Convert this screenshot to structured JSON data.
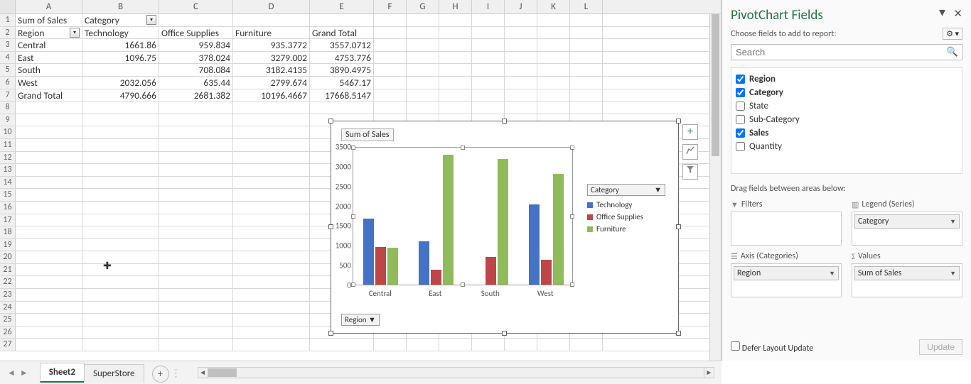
{
  "pivot": {
    "header_row": {
      "sum_label": "Sum of Sales",
      "cat_label": "Category"
    },
    "col_row": {
      "region_label": "Region",
      "c1": "Technology",
      "c2": "Office Supplies",
      "c3": "Furniture",
      "c4": "Grand Total"
    },
    "rows": [
      {
        "region": "Central",
        "tech": "1661.86",
        "off": "959.834",
        "fur": "935.3772",
        "tot": "3557.0712"
      },
      {
        "region": "East",
        "tech": "1096.75",
        "off": "378.024",
        "fur": "3279.002",
        "tot": "4753.776"
      },
      {
        "region": "South",
        "tech": "",
        "off": "708.084",
        "fur": "3182.4135",
        "tot": "3890.4975"
      },
      {
        "region": "West",
        "tech": "2032.056",
        "off": "635.44",
        "fur": "2799.674",
        "tot": "5467.17"
      },
      {
        "region": "Grand Total",
        "tech": "4790.666",
        "off": "2681.382",
        "fur": "10196.4667",
        "tot": "17668.5147"
      }
    ]
  },
  "columns": [
    "A",
    "B",
    "C",
    "D",
    "E",
    "F",
    "G",
    "H",
    "I",
    "J",
    "K",
    "L"
  ],
  "pane": {
    "title": "PivotChart Fields",
    "subtitle": "Choose fields to add to report:",
    "search_placeholder": "Search",
    "fields": [
      {
        "name": "Region",
        "checked": true
      },
      {
        "name": "Category",
        "checked": true
      },
      {
        "name": "State",
        "checked": false
      },
      {
        "name": "Sub-Category",
        "checked": false
      },
      {
        "name": "Sales",
        "checked": true
      },
      {
        "name": "Quantity",
        "checked": false
      }
    ],
    "drag_label": "Drag fields between areas below:",
    "areas": {
      "filters": {
        "title": "Filters"
      },
      "legend": {
        "title": "Legend (Series)",
        "chip": "Category"
      },
      "axis": {
        "title": "Axis (Categories)",
        "chip": "Region"
      },
      "values": {
        "title": "Values",
        "chip": "Sum of Sales"
      }
    },
    "defer_label": "Defer Layout Update",
    "update_label": "Update"
  },
  "tabs": {
    "active": "Sheet2",
    "other": "SuperStore"
  },
  "chart": {
    "title": "Sum of Sales",
    "legend_title": "Category",
    "legend_items": [
      {
        "name": "Technology",
        "color": "#4472c4"
      },
      {
        "name": "Office Supplies",
        "color": "#bf4646"
      },
      {
        "name": "Furniture",
        "color": "#8fbb5a"
      }
    ],
    "axis_button": "Region",
    "y_ticks": [
      "0",
      "500",
      "1000",
      "1500",
      "2000",
      "2500",
      "3000",
      "3500"
    ],
    "categories": [
      "Central",
      "East",
      "South",
      "West"
    ]
  },
  "chart_data": {
    "type": "bar",
    "title": "Sum of Sales",
    "xlabel": "Region",
    "ylabel": "",
    "ylim": [
      0,
      3500
    ],
    "categories": [
      "Central",
      "East",
      "South",
      "West"
    ],
    "series": [
      {
        "name": "Technology",
        "values": [
          1662,
          1097,
          0,
          2032
        ]
      },
      {
        "name": "Office Supplies",
        "values": [
          960,
          378,
          708,
          635
        ]
      },
      {
        "name": "Furniture",
        "values": [
          935,
          3279,
          3182,
          2800
        ]
      }
    ]
  }
}
